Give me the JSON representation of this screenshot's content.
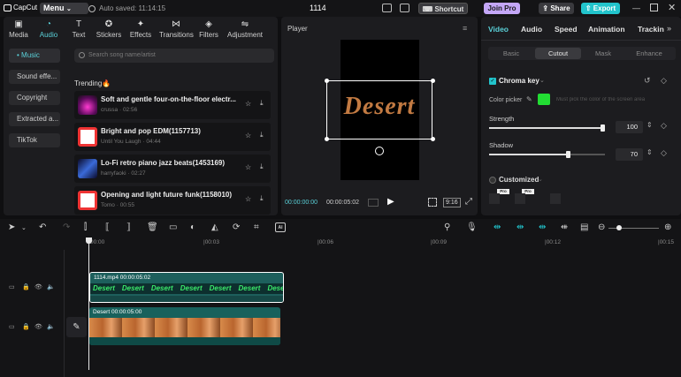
{
  "titlebar": {
    "logo": "CapCut",
    "menu": "Menu",
    "autosave": "Auto saved: 11:14:15",
    "project_name": "1114",
    "shortcut": "Shortcut",
    "join_pro": "Join Pro",
    "share": "Share",
    "export": "Export"
  },
  "media_tabs": [
    {
      "label": "Media",
      "icon": "media-icon"
    },
    {
      "label": "Audio",
      "icon": "audio-icon"
    },
    {
      "label": "Text",
      "icon": "text-icon"
    },
    {
      "label": "Stickers",
      "icon": "stickers-icon"
    },
    {
      "label": "Effects",
      "icon": "effects-icon"
    },
    {
      "label": "Transitions",
      "icon": "transitions-icon"
    },
    {
      "label": "Filters",
      "icon": "filters-icon"
    },
    {
      "label": "Adjustment",
      "icon": "adjustment-icon"
    }
  ],
  "audio_categories": [
    "• Music",
    "Sound effe...",
    "Copyright",
    "Extracted a...",
    "TikTok"
  ],
  "search_placeholder": "Search song name/artist",
  "trending_label": "Trending🔥",
  "tracks": [
    {
      "title": "Soft and gentle four-on-the-floor electr...",
      "artist": "crussa",
      "duration": "02:56"
    },
    {
      "title": "Bright and pop EDM(1157713)",
      "artist": "Until You Laugh",
      "duration": "04:44"
    },
    {
      "title": "Lo-Fi retro piano jazz beats(1453169)",
      "artist": "harryfaoki",
      "duration": "02:27"
    },
    {
      "title": "Opening and light future funk(1158010)",
      "artist": "Tomo",
      "duration": "00:55"
    }
  ],
  "player": {
    "title": "Player",
    "overlay_text": "Desert",
    "current_time": "00:00:00:00",
    "total_time": "00:00:05:02",
    "ratio": "9:16"
  },
  "right_tabs": [
    "Video",
    "Audio",
    "Speed",
    "Animation",
    "Trackin"
  ],
  "video_subtabs": [
    "Basic",
    "Cutout",
    "Mask",
    "Enhance"
  ],
  "chroma_key": {
    "label": "Chroma key",
    "color_picker_label": "Color picker",
    "picker_hint": "Must pick the color of the screen area",
    "strength_label": "Strength",
    "strength_value": "100",
    "shadow_label": "Shadow",
    "shadow_value": "70",
    "strength_level": 1.0,
    "shadow_level": 0.7
  },
  "customized": {
    "label": "Customized",
    "tags": [
      "Pro",
      "Pro"
    ]
  },
  "timeline": {
    "ruler_marks": [
      "00:00",
      "|00:03",
      "|00:06",
      "|00:09",
      "|00:12",
      "|00:15"
    ],
    "text_clip": {
      "name": "1114.mp4",
      "duration": "00:00:05:02",
      "word": "Desert",
      "repeat": 7
    },
    "video_clip": {
      "name": "Desert",
      "duration": "00:00:05:00"
    }
  },
  "colors": {
    "accent": "#5ad0d8",
    "join_pro": "#c4a7f7",
    "export": "#22c4cc",
    "chroma_green": "#22dd33",
    "text_clip_bg": "#1d5f5c",
    "video_clip_bg": "#18615c"
  }
}
